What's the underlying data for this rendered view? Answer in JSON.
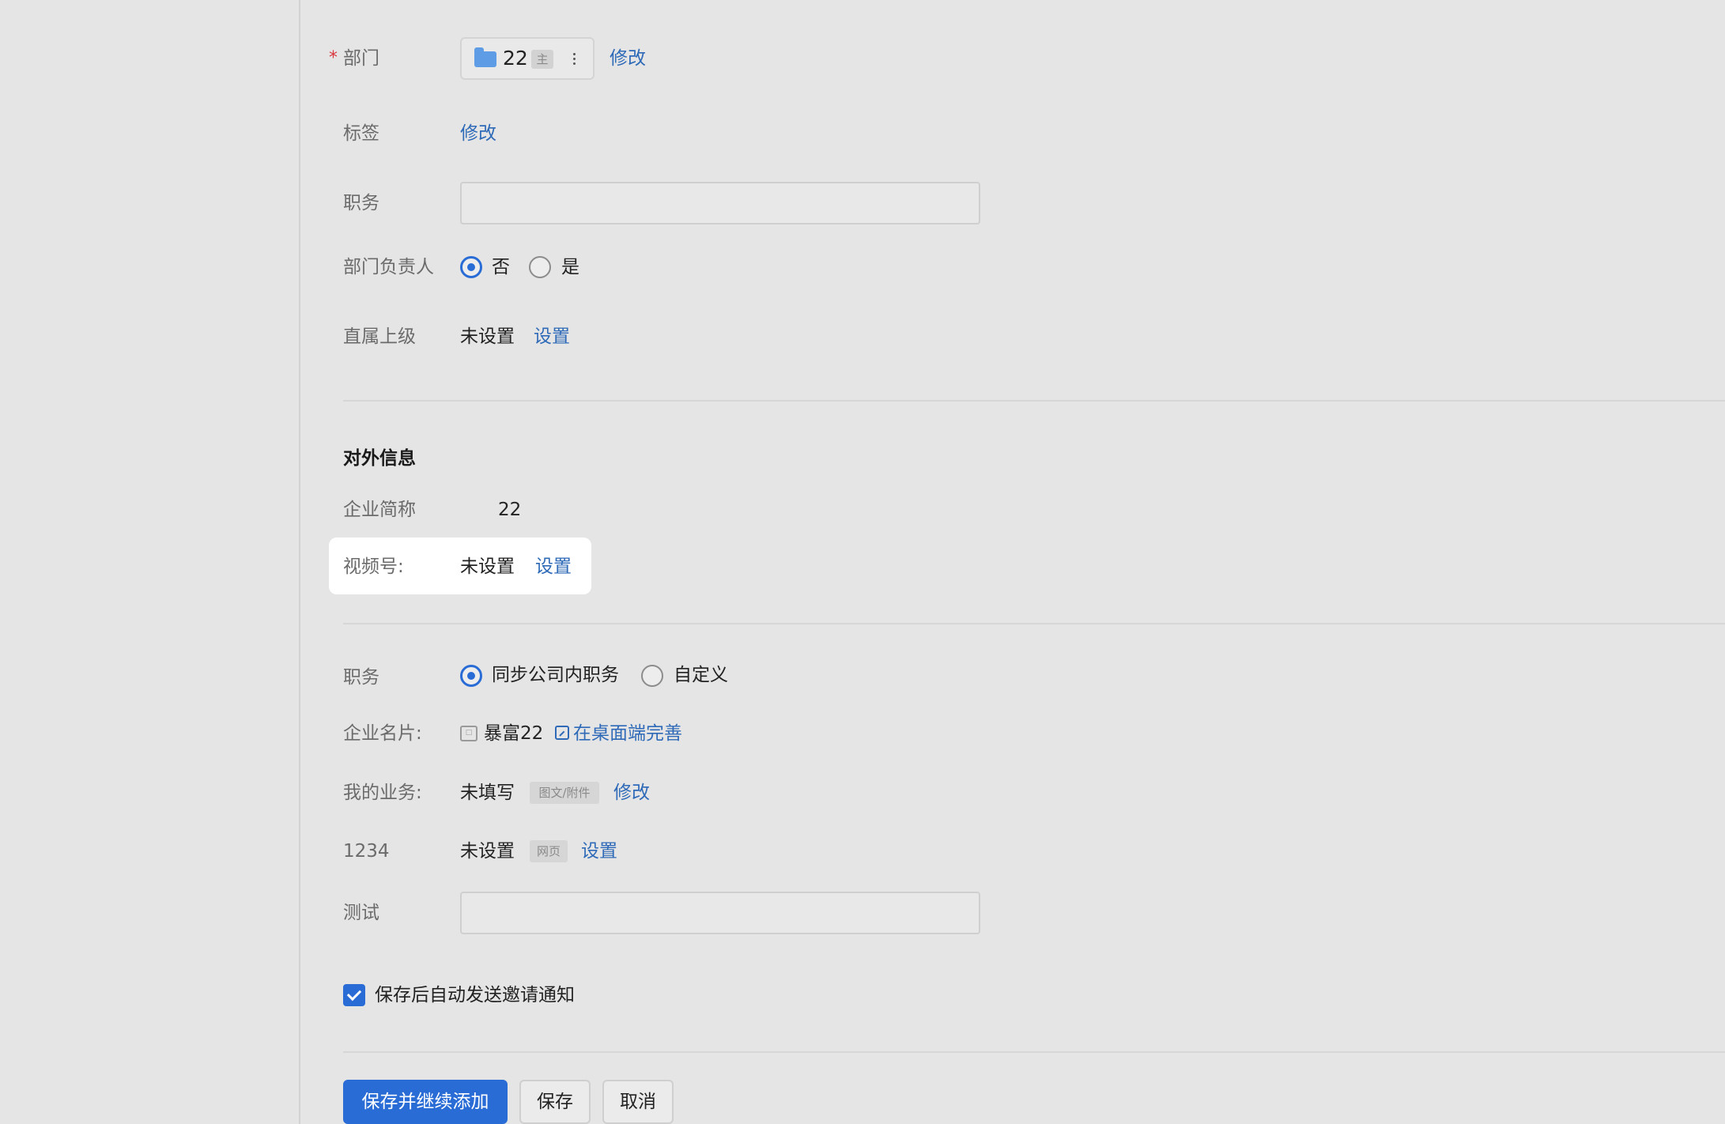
{
  "department": {
    "label": "部门",
    "required_mark": "*",
    "chip_value": "22",
    "chip_badge": "主",
    "edit_link": "修改"
  },
  "tags": {
    "label": "标签",
    "edit_link": "修改"
  },
  "position": {
    "label": "职务",
    "value": ""
  },
  "dept_head": {
    "label": "部门负责人",
    "options": [
      "否",
      "是"
    ],
    "selected": "否"
  },
  "direct_superior": {
    "label": "直属上级",
    "value": "未设置",
    "action": "设置"
  },
  "external_info": {
    "title": "对外信息",
    "company_short_name": {
      "label": "企业简称",
      "value": "22"
    },
    "video_account": {
      "label": "视频号:",
      "value": "未设置",
      "action": "设置"
    },
    "position": {
      "label": "职务",
      "options": [
        "同步公司内职务",
        "自定义"
      ],
      "selected": "同步公司内职务"
    },
    "business_card": {
      "label": "企业名片:",
      "value": "暴富22",
      "action": "在桌面端完善"
    },
    "my_business": {
      "label": "我的业务:",
      "value": "未填写",
      "tag": "图文/附件",
      "action": "修改"
    },
    "field_1234": {
      "label": "1234",
      "value": "未设置",
      "tag": "网页",
      "action": "设置"
    },
    "test_field": {
      "label": "测试",
      "value": ""
    }
  },
  "auto_invite": {
    "label": "保存后自动发送邀请通知",
    "checked": true
  },
  "buttons": {
    "save_and_continue": "保存并继续添加",
    "save": "保存",
    "cancel": "取消"
  },
  "colors": {
    "accent": "#2a6cd6",
    "link": "#2e6ab8",
    "background": "#e5e5e5",
    "required": "#d9363e"
  }
}
